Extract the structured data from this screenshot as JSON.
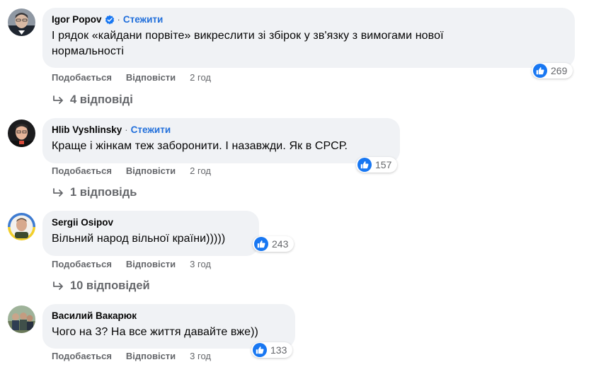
{
  "comments": [
    {
      "author": "Igor Popov",
      "verified": true,
      "follow": "Стежити",
      "text_lines": [
        "І рядок «кайдани порвіте» викреслити зі збірок у зв'язку з вимогами нової",
        "нормальності"
      ],
      "reaction_icon": "like-icon",
      "reactions": "269",
      "like_label": "Подобається",
      "reply_label": "Відповісти",
      "time": "2 год",
      "replies_label": "4 відповіді"
    },
    {
      "author": "Hlib Vyshlinsky",
      "verified": false,
      "follow": "Стежити",
      "text_lines": [
        "Краще і жінкам теж заборонити. І назавжди. Як в СРСР."
      ],
      "reaction_icon": "like-icon",
      "reactions": "157",
      "like_label": "Подобається",
      "reply_label": "Відповісти",
      "time": "2 год",
      "replies_label": "1 відповідь"
    },
    {
      "author": "Sergii Osipov",
      "verified": false,
      "text_lines": [
        "Вільний народ вільної країни)))))"
      ],
      "reaction_icon": "like-icon",
      "reactions": "243",
      "like_label": "Подобається",
      "reply_label": "Відповісти",
      "time": "3 год",
      "replies_label": "10 відповідей"
    },
    {
      "author": "Василий Вакарюк",
      "verified": false,
      "text_lines": [
        "Чого на 3? На все життя давайте вже))"
      ],
      "reaction_icon": "like-icon",
      "reactions": "133",
      "like_label": "Подобається",
      "reply_label": "Відповісти",
      "time": "3 год"
    }
  ],
  "colors": {
    "bubble": "#f0f2f5",
    "follow": "#216fdb",
    "muted": "#65676b",
    "like": "#1877f2"
  }
}
